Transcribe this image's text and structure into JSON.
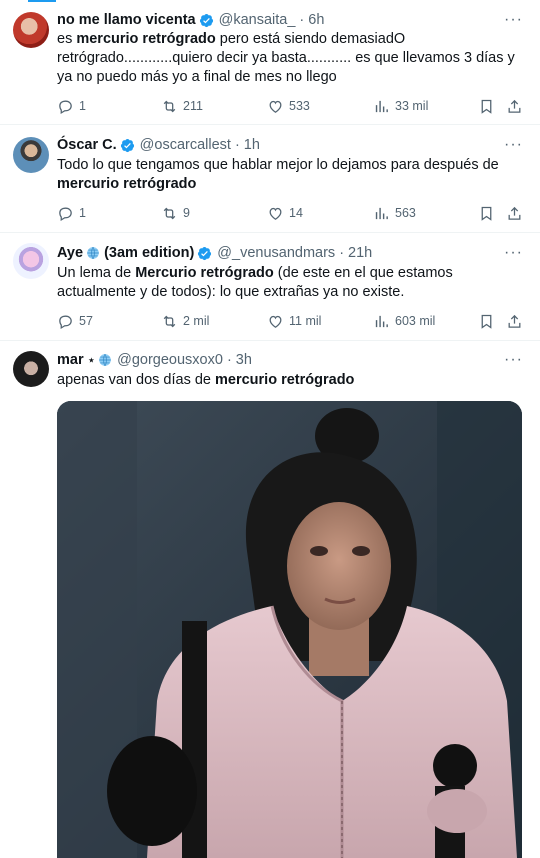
{
  "tweets": [
    {
      "name": "no me llamo vicenta",
      "handle": "@kansaita_",
      "time": "6h",
      "verified": true,
      "text_segments": [
        {
          "t": "es ",
          "b": false
        },
        {
          "t": "mercurio retrógrado",
          "b": true
        },
        {
          "t": " pero está siendo demasiadO retrógrado............quiero decir ya basta........... es que llevamos 3 días y ya no puedo más yo a final de mes no llego",
          "b": false
        }
      ],
      "replies": "1",
      "retweets": "211",
      "likes": "533",
      "views": "33 mil"
    },
    {
      "name": "Óscar C.",
      "handle": "@oscarcallest",
      "time": "1h",
      "verified": true,
      "text_segments": [
        {
          "t": "Todo lo que tengamos que hablar mejor lo dejamos para después de ",
          "b": false
        },
        {
          "t": "mercurio retrógrado",
          "b": true
        }
      ],
      "replies": "1",
      "retweets": "9",
      "likes": "14",
      "views": "563"
    },
    {
      "name": "Aye",
      "name_suffix": "(3am edition)",
      "handle": "@_venusandmars",
      "time": "21h",
      "verified": true,
      "text_segments": [
        {
          "t": "Un lema de ",
          "b": false
        },
        {
          "t": "Mercurio retrógrado",
          "b": true
        },
        {
          "t": " (de este en el que estamos actualmente y de todos): lo que extrañas ya no existe.",
          "b": false
        }
      ],
      "replies": "57",
      "retweets": "2 mil",
      "likes": "11 mil",
      "views": "603 mil"
    },
    {
      "name": "mar",
      "name_suffix": "⋆",
      "handle": "@gorgeousxox0",
      "time": "3h",
      "verified": false,
      "text_segments": [
        {
          "t": "apenas van dos días de ",
          "b": false
        },
        {
          "t": "mercurio retrógrado",
          "b": true
        }
      ]
    }
  ],
  "dot": "·",
  "more_glyph": "···",
  "icons": [
    "reply-icon",
    "retweet-icon",
    "like-icon",
    "views-icon",
    "bookmark-icon",
    "share-icon",
    "more-icon",
    "verified-badge-icon"
  ],
  "colors": {
    "accent": "#1d9bf0",
    "secondary_text": "#536471",
    "border": "#eff3f4"
  }
}
